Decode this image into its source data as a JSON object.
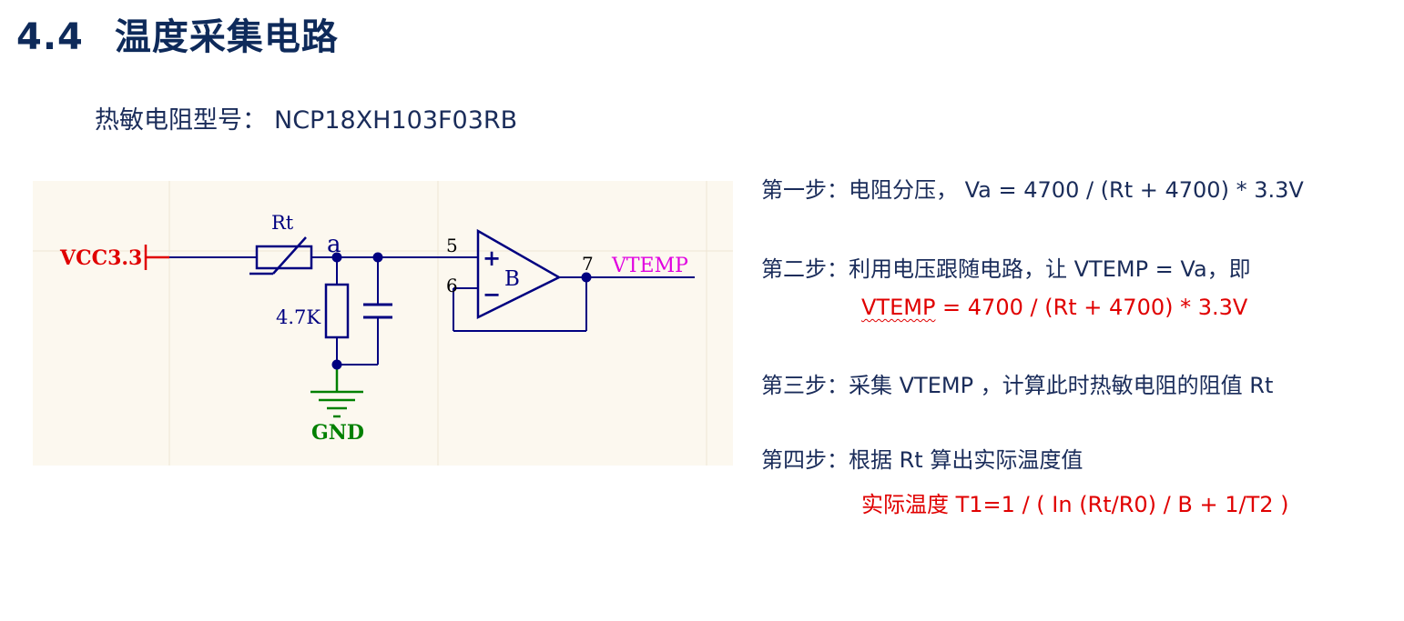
{
  "title": {
    "number": "4.4",
    "text": "温度采集电路"
  },
  "model": {
    "label": "热敏电阻型号：",
    "value": "NCP18XH103F03RB"
  },
  "schematic": {
    "vcc_label": "VCC3.3",
    "rt_label": "Rt",
    "node_label": "a",
    "resistor_label": "4.7K",
    "gnd_label": "GND",
    "pin_plus": "5",
    "pin_minus": "6",
    "pin_out": "7",
    "plus_sign": "+",
    "minus_sign": "−",
    "opamp_label": "B",
    "output_label": "VTEMP",
    "colors": {
      "wire": "#000080",
      "vcc": "#e00000",
      "gnd": "#008000",
      "output": "#e000e0",
      "junction": "#000080"
    }
  },
  "steps": [
    {
      "prefix": "第一步：",
      "text": "电阻分压， Va = 4700 / (Rt + 4700) * 3.3V"
    },
    {
      "prefix": "第二步：",
      "text": "利用电压跟随电路，让 VTEMP = Va，即"
    },
    {
      "formula_a": "VTEMP",
      "formula_b": " =  4700 / (Rt + 4700) * 3.3V"
    },
    {
      "prefix": "第三步：",
      "text": "采集 VTEMP ，计算此时热敏电阻的阻值 Rt"
    },
    {
      "prefix": "第四步：",
      "text": "根据 Rt 算出实际温度值"
    },
    {
      "formula": "实际温度  T1=1 / (  In (Rt/R0) / B + 1/T2 )"
    }
  ],
  "colors": {
    "title": "#0e2a5a",
    "text": "#1a2c5a",
    "highlight": "#e00000"
  }
}
